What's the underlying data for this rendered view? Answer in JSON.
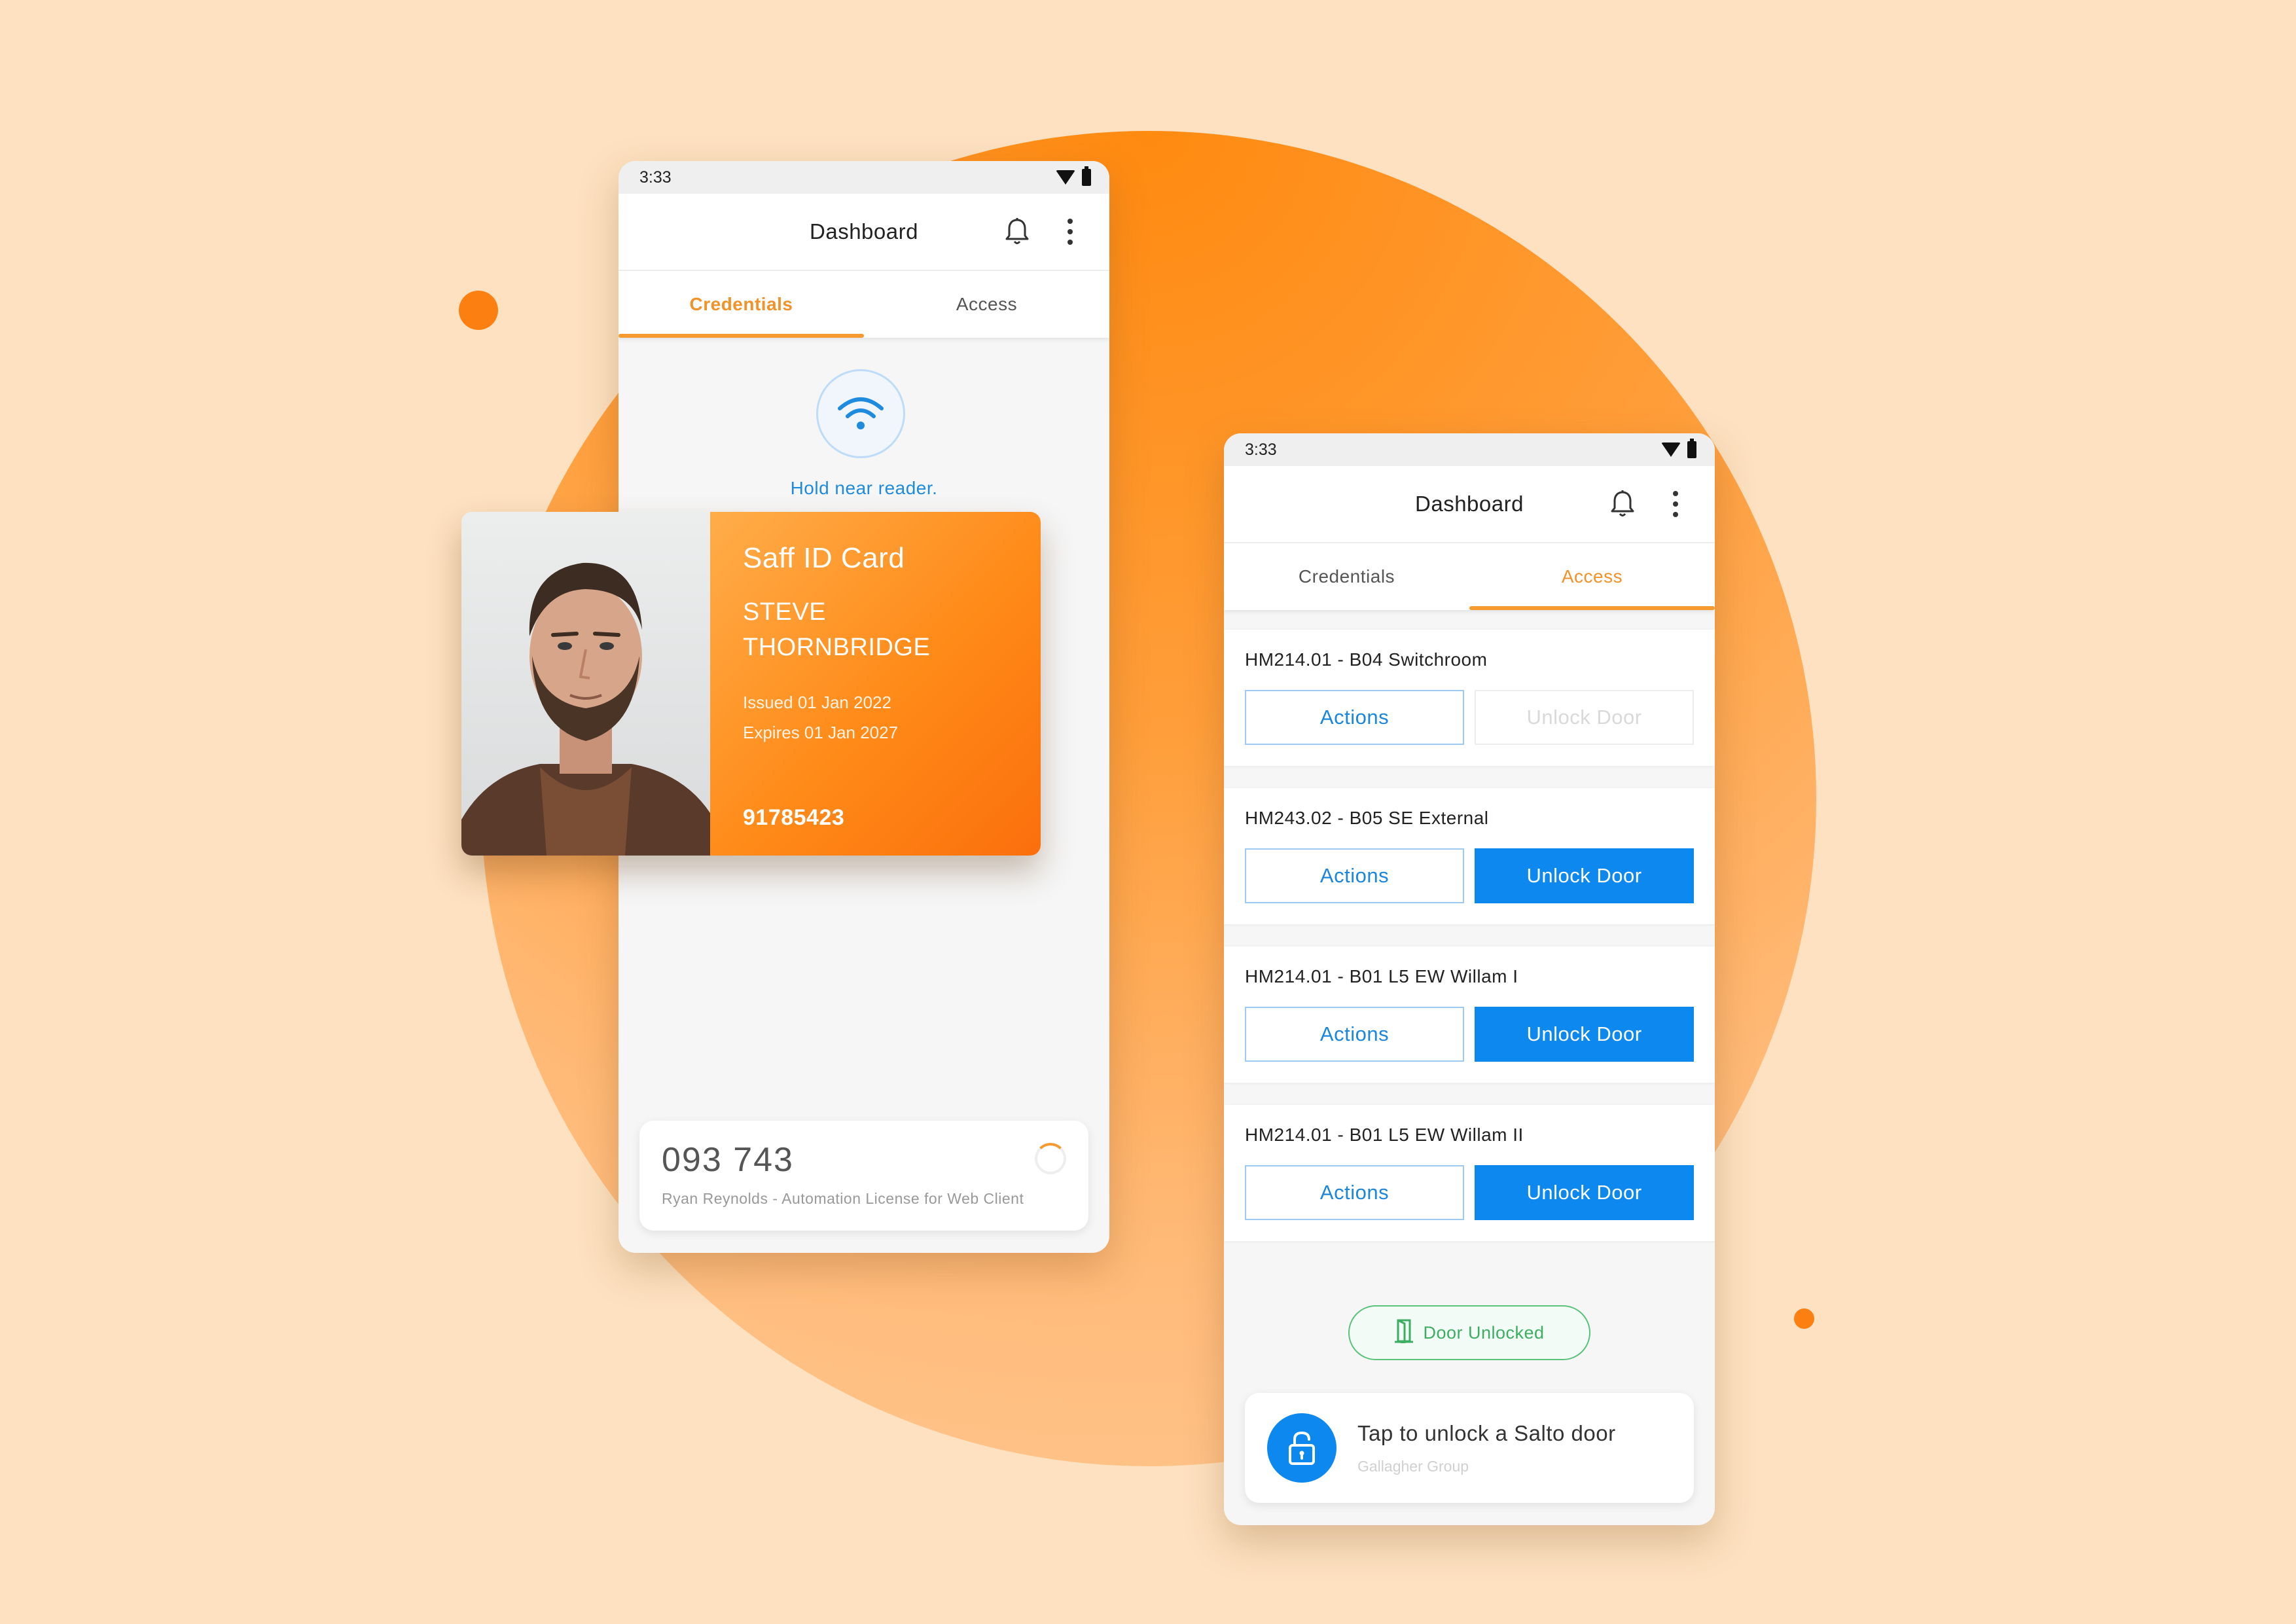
{
  "colors": {
    "background": "#fde1c0",
    "accent_orange": "#f59a2e",
    "primary_blue": "#0c88ee",
    "success_green": "#3cae62"
  },
  "credentials_screen": {
    "status_time": "3:33",
    "title": "Dashboard",
    "tabs": [
      {
        "label": "Credentials",
        "active": true
      },
      {
        "label": "Access",
        "active": false
      }
    ],
    "nfc": {
      "icon": "wifi-icon",
      "text": "Hold near reader."
    },
    "otp": {
      "code": "093 743",
      "subtitle": "Ryan Reynolds - Automation License for Web Client"
    }
  },
  "id_card": {
    "title": "Saff ID Card",
    "name": "STEVE THORNBRIDGE",
    "issued": "Issued 01 Jan 2022",
    "expires": "Expires 01 Jan 2027",
    "number": "91785423"
  },
  "access_screen": {
    "status_time": "3:33",
    "title": "Dashboard",
    "tabs": [
      {
        "label": "Credentials",
        "active": false
      },
      {
        "label": "Access",
        "active": true
      }
    ],
    "doors": [
      {
        "name": "HM214.01 - B04 Switchroom",
        "actions_label": "Actions",
        "unlock_label": "Unlock Door",
        "unlock_enabled": false
      },
      {
        "name": "HM243.02 - B05 SE External",
        "actions_label": "Actions",
        "unlock_label": "Unlock Door",
        "unlock_enabled": true
      },
      {
        "name": "HM214.01 - B01 L5 EW Willam I",
        "actions_label": "Actions",
        "unlock_label": "Unlock Door",
        "unlock_enabled": true
      },
      {
        "name": "HM214.01 - B01 L5 EW Willam II",
        "actions_label": "Actions",
        "unlock_label": "Unlock Door",
        "unlock_enabled": true
      }
    ],
    "badge": {
      "icon": "door-icon",
      "label": "Door Unlocked"
    },
    "salto": {
      "icon": "lock-icon",
      "title": "Tap to unlock a Salto door",
      "subtitle": "Gallagher Group"
    }
  }
}
